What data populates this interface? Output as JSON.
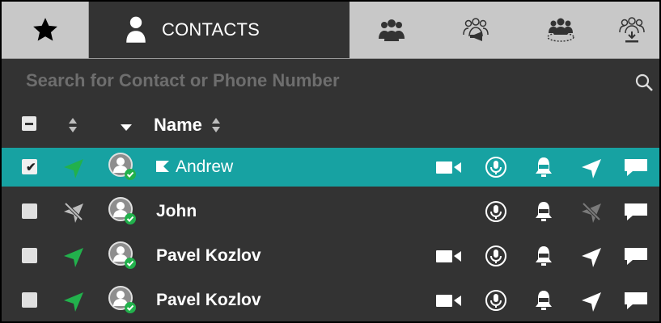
{
  "tabs": {
    "contacts_label": "CONTACTS",
    "favorites_icon": "star-icon",
    "contacts_icon": "person-icon",
    "groups_icons": [
      "group-icon",
      "broadcast-group-icon",
      "nearby-group-icon",
      "download-group-icon"
    ]
  },
  "search": {
    "placeholder": "Search for Contact or Phone Number",
    "value": ""
  },
  "header": {
    "name_label": "Name"
  },
  "contacts": [
    {
      "name": "Andrew",
      "selected": true,
      "checked": true,
      "flagged": true,
      "location_on": true,
      "video": true
    },
    {
      "name": "John",
      "selected": false,
      "checked": false,
      "flagged": false,
      "location_on": false,
      "video": false
    },
    {
      "name": "Pavel Kozlov",
      "selected": false,
      "checked": false,
      "flagged": false,
      "location_on": true,
      "video": true
    },
    {
      "name": "Pavel Kozlov",
      "selected": false,
      "checked": false,
      "flagged": false,
      "location_on": true,
      "video": true
    }
  ],
  "colors": {
    "accent": "#17a2a2",
    "panel": "#333333",
    "tabbar": "#c8c8c8",
    "status_green": "#22b14c",
    "disabled_icon": "#8a8a8a"
  }
}
